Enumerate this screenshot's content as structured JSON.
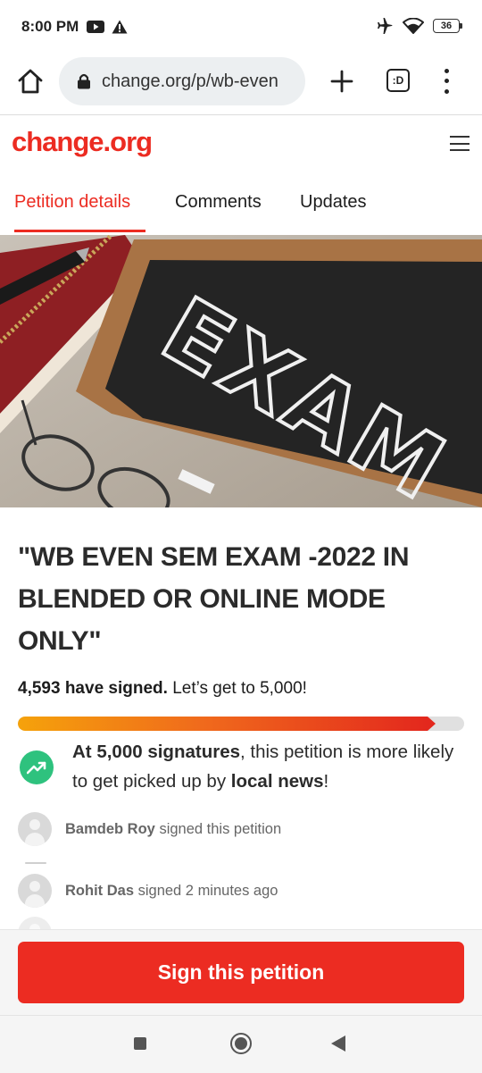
{
  "status_bar": {
    "time": "8:00 PM",
    "battery": "36",
    "icons": [
      "youtube-icon",
      "alert-icon",
      "airplane-icon",
      "wifi-icon",
      "battery-icon"
    ]
  },
  "browser": {
    "url": "change.org/p/wb-even",
    "tabs_count": ":D"
  },
  "site": {
    "logo": "change.org",
    "brand_color": "#ec2c22"
  },
  "tabs": [
    {
      "label": "Petition details",
      "active": true
    },
    {
      "label": "Comments",
      "active": false
    },
    {
      "label": "Updates",
      "active": false
    }
  ],
  "hero": {
    "board_text": "EXAM"
  },
  "petition": {
    "title": "\"WB EVEN SEM EXAM -2022 IN BLENDED OR ONLINE MODE ONLY\"",
    "signed_count": "4,593 have signed.",
    "goal_text": " Let’s get to 5,000!",
    "progress_fraction": 0.9186
  },
  "milestone": {
    "bold_1": "At 5,000 signatures",
    "text_1": ", this petition is more likely to get picked up by ",
    "bold_2": "local news",
    "text_2": "!"
  },
  "signers": [
    {
      "name": "Bamdeb Roy",
      "action": " signed this petition"
    },
    {
      "name": "Rohit Das",
      "action": " signed 2 minutes ago"
    }
  ],
  "cta": {
    "label": "Sign this petition"
  }
}
